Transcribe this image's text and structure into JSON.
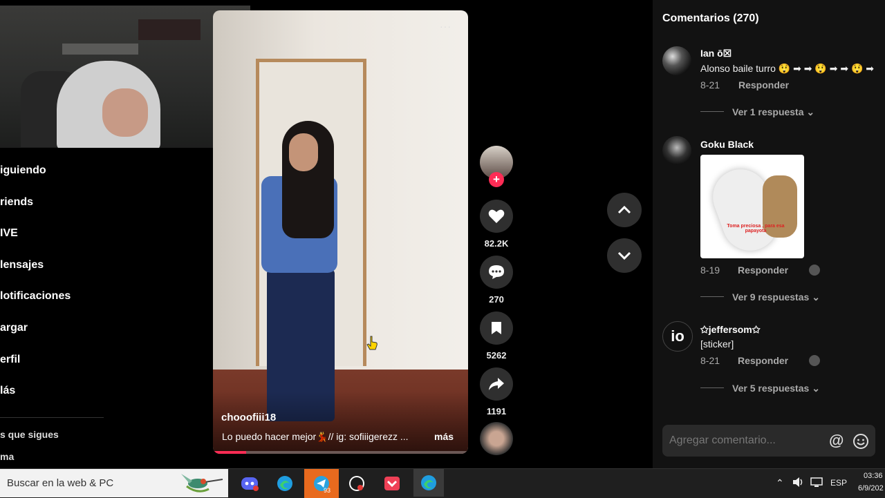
{
  "sidebar": {
    "items": [
      {
        "label": "iguiendo"
      },
      {
        "label": "riends"
      },
      {
        "label": "IVE"
      },
      {
        "label": "lensajes"
      },
      {
        "label": "lotificaciones"
      },
      {
        "label": "argar"
      },
      {
        "label": "erfil"
      },
      {
        "label": "lás"
      }
    ],
    "section_label": "s que sigues",
    "extra_label": "ma"
  },
  "video": {
    "author": "chooofiii18",
    "caption": "Lo puedo hacer mejor💃// ig: sofiiigerezz ...",
    "more_label": "más",
    "more_dots": "···",
    "progress": 0.13
  },
  "actions": {
    "likes": "82.2K",
    "comments": "270",
    "saves": "5262",
    "shares": "1191",
    "follow_plus": "+"
  },
  "comments_panel": {
    "title": "Comentarios (270)",
    "input_placeholder": "Agregar comentario...",
    "comments": [
      {
        "user": "Ian ō☒",
        "text": "Alonso baile turro 😲 ➡ ➡ 😲 ➡ ➡ 😲 ➡",
        "date": "8-21",
        "reply_label": "Responder",
        "replies_label": "Ver 1 respuesta"
      },
      {
        "user": "Goku Black",
        "text": "",
        "sticker_text": "Toma preciosa , para esa papayota",
        "date": "8-19",
        "reply_label": "Responder",
        "replies_label": "Ver 9 respuestas"
      },
      {
        "user": "✩jeffersom✩",
        "text": "[sticker]",
        "avatar_text": "io",
        "date": "8-21",
        "reply_label": "Responder",
        "replies_label": "Ver 5 respuestas"
      }
    ]
  },
  "taskbar": {
    "search_text": "Buscar en la web & PC",
    "telegram_badge": "93",
    "language": "ESP",
    "time": "03:36",
    "date": "6/9/202"
  },
  "colors": {
    "accent": "#fe2c55",
    "panel_bg": "#121212",
    "action_circle": "#2f2f2f"
  }
}
